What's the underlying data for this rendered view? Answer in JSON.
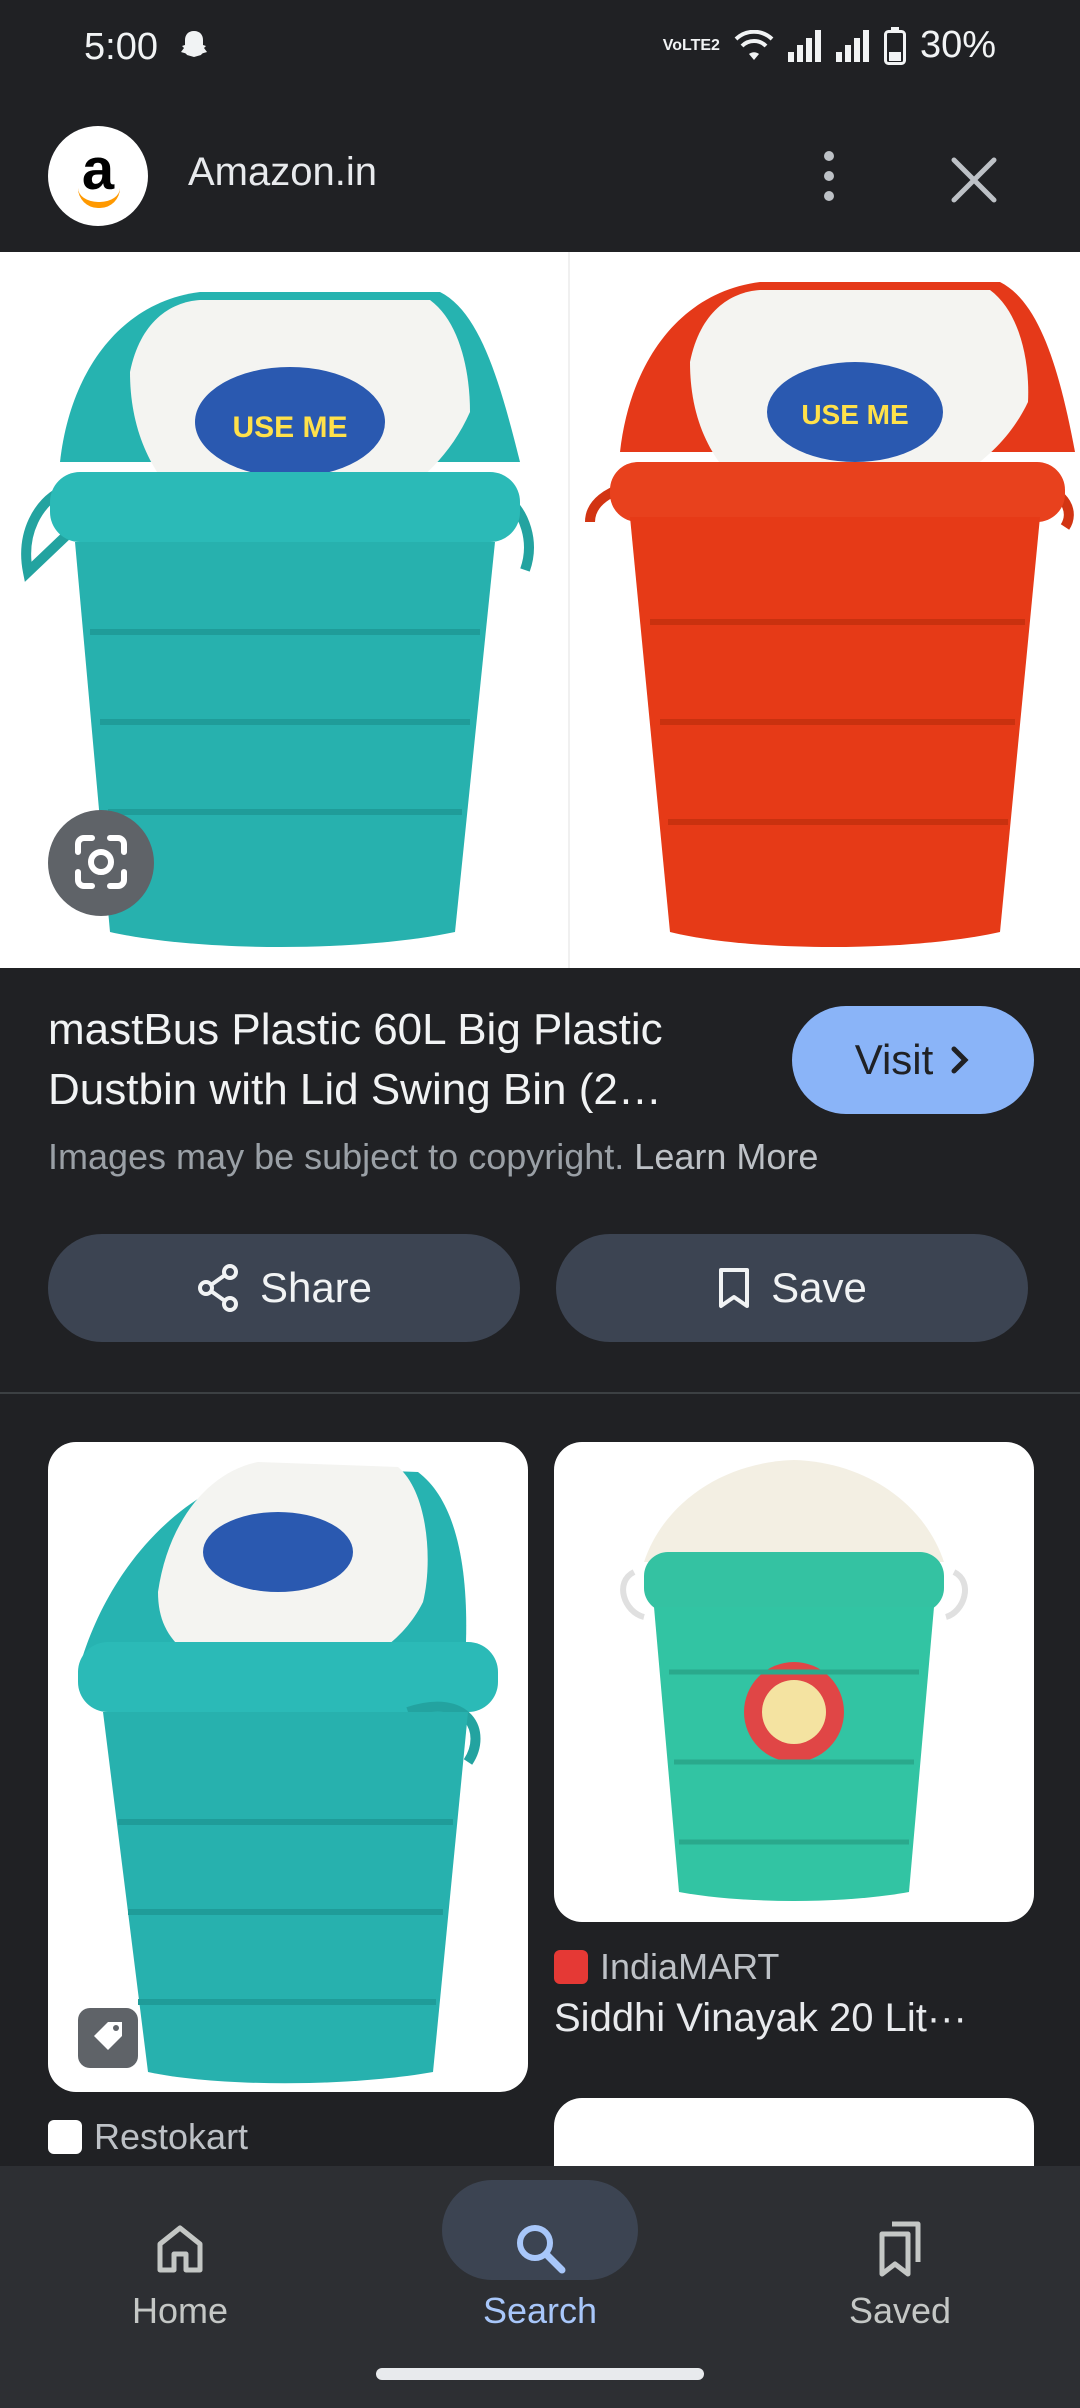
{
  "status_bar": {
    "time": "5:00",
    "network": "VoLTE2",
    "battery": "30%"
  },
  "source_header": {
    "site": "Amazon.in",
    "icons": [
      "amazon-logo",
      "more-vert-icon",
      "close-icon"
    ]
  },
  "result": {
    "title": "mastBus Plastic 60L Big Plastic Dustbin with Lid Swing Bin (2…",
    "visit_label": "Visit",
    "copyright_text": "Images may be subject to copyright.",
    "learn_more": "Learn More",
    "share_label": "Share",
    "save_label": "Save",
    "product_colors": {
      "teal": "#26b3b0",
      "red": "#e53919",
      "lid": "#f4f4f1"
    }
  },
  "grid": [
    {
      "source": "Restokart",
      "title": ""
    },
    {
      "source": "IndiaMART",
      "title": "Siddhi Vinayak 20 Lit···"
    }
  ],
  "bottom_nav": {
    "items": [
      {
        "label": "Home",
        "icon": "home-icon"
      },
      {
        "label": "Search",
        "icon": "search-icon",
        "active": true
      },
      {
        "label": "Saved",
        "icon": "bookmarks-icon"
      }
    ],
    "active_color": "#a8c7fa"
  }
}
